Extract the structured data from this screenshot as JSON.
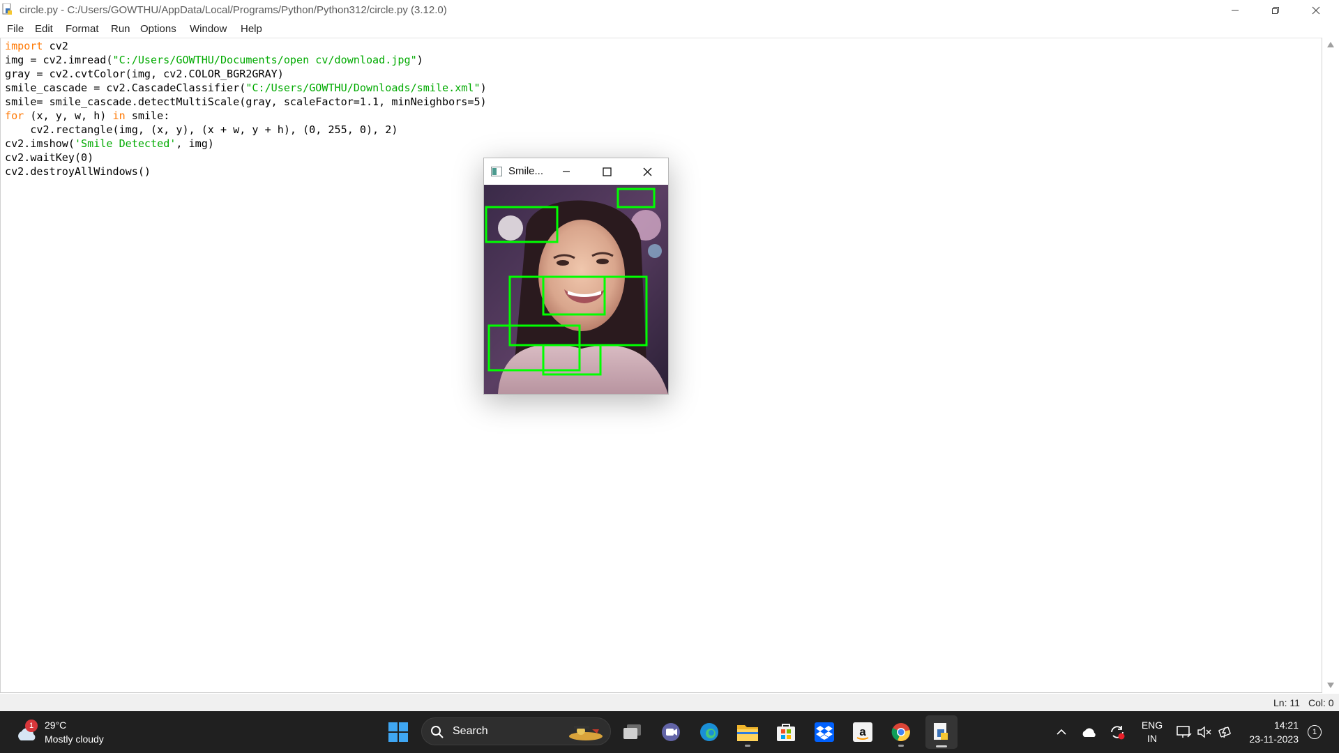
{
  "window": {
    "title": "circle.py - C:/Users/GOWTHU/AppData/Local/Programs/Python/Python312/circle.py (3.12.0)"
  },
  "menu": [
    "File",
    "Edit",
    "Format",
    "Run",
    "Options",
    "Window",
    "Help"
  ],
  "code": {
    "lines": [
      [
        {
          "t": "import",
          "c": "kw"
        },
        {
          "t": " cv2"
        }
      ],
      [
        {
          "t": "img = cv2.imread("
        },
        {
          "t": "\"C:/Users/GOWTHU/Documents/open cv/download.jpg\"",
          "c": "st"
        },
        {
          "t": ")"
        }
      ],
      [
        {
          "t": "gray = cv2.cvtColor(img, cv2.COLOR_BGR2GRAY)"
        }
      ],
      [
        {
          "t": "smile_cascade = cv2.CascadeClassifier("
        },
        {
          "t": "\"C:/Users/GOWTHU/Downloads/smile.xml\"",
          "c": "st"
        },
        {
          "t": ")"
        }
      ],
      [
        {
          "t": "smile= smile_cascade.detectMultiScale(gray, scaleFactor=1.1, minNeighbors=5)"
        }
      ],
      [
        {
          "t": "for",
          "c": "kw"
        },
        {
          "t": " (x, y, w, h) "
        },
        {
          "t": "in",
          "c": "kw"
        },
        {
          "t": " smile:"
        }
      ],
      [
        {
          "t": "    cv2.rectangle(img, (x, y), (x + w, y + h), (0, 255, 0), 2)"
        }
      ],
      [
        {
          "t": "cv2.imshow("
        },
        {
          "t": "'Smile Detected'",
          "c": "st"
        },
        {
          "t": ", img)"
        }
      ],
      [
        {
          "t": "cv2.waitKey(0)"
        }
      ],
      [
        {
          "t": "cv2.destroyAllWindows()"
        }
      ]
    ],
    "colors": {
      "keyword": "#ff7700",
      "string": "#00aa00"
    }
  },
  "status": {
    "line": "Ln: 11",
    "col": "Col: 0"
  },
  "cv_window": {
    "title": "Smile..."
  },
  "taskbar": {
    "weather": {
      "temp": "29°C",
      "desc": "Mostly cloudy",
      "badge": "1"
    },
    "search_label": "Search",
    "lang": "ENG",
    "region": "IN",
    "time": "14:21",
    "date": "23-11-2023",
    "notification_count": "1"
  }
}
